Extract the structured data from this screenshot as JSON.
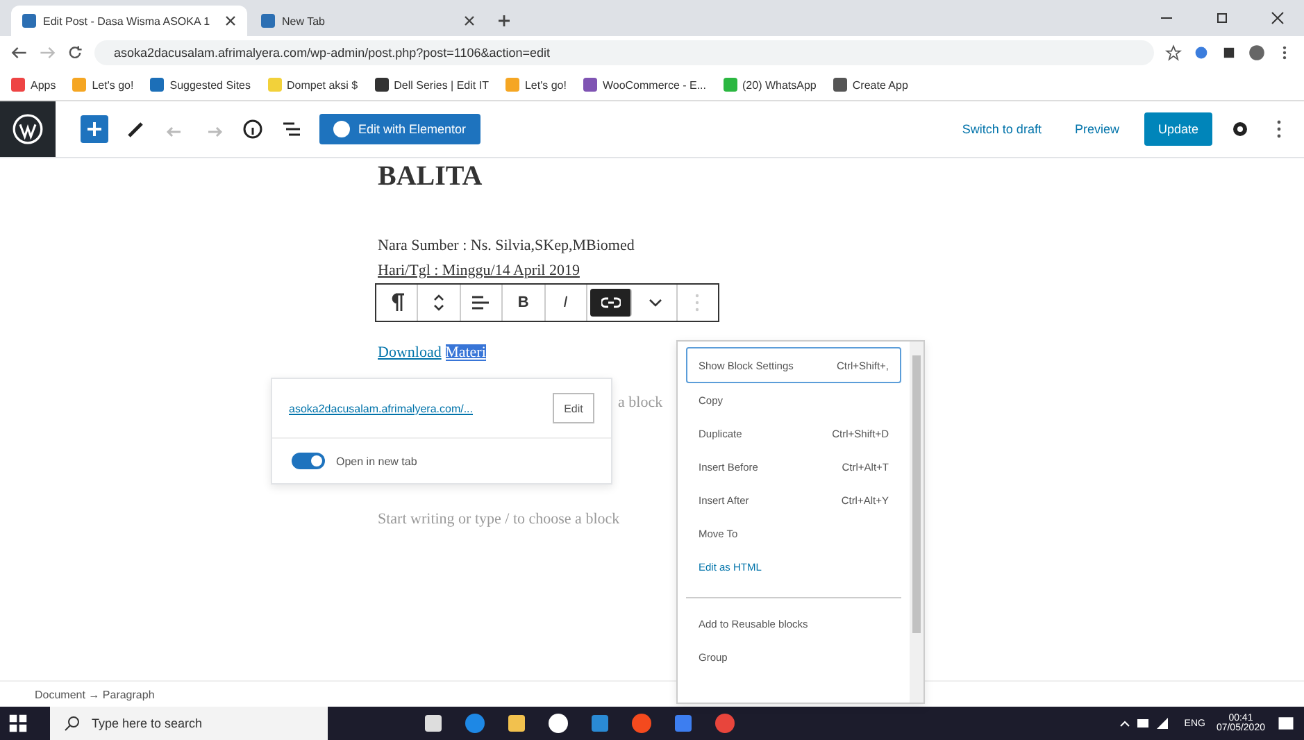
{
  "browser": {
    "tabs": [
      {
        "title": "Edit Post - Dasa Wisma ASOKA 1",
        "selected": true
      },
      {
        "title": "New Tab",
        "selected": false
      }
    ],
    "url": "asoka2dacusalam.afrimalyera.com/wp-admin/post.php?post=1106&action=edit",
    "bookmarks": [
      "Apps",
      "Let's go!",
      "Suggested Sites",
      "Dompet aksi $",
      "Dell Series | Edit IT",
      "Let's go!",
      "WooCommerce - E...",
      "(20) WhatsApp",
      "Create App"
    ]
  },
  "wp_toolbar": {
    "elementor": "Edit with Elementor",
    "switch_draft": "Switch to draft",
    "preview": "Preview",
    "update": "Update"
  },
  "editor": {
    "heading": "BALITA",
    "lines": [
      "Nara Sumber : Ns. Silvia,SKep,MBiomed",
      "Hari/Tgl : Minggu/14 April 2019"
    ],
    "block_toolbar": [
      {
        "kind": "paragraph",
        "selected": false
      },
      {
        "kind": "move",
        "selected": false
      },
      {
        "kind": "align",
        "selected": false
      },
      {
        "kind": "bold",
        "label": "B",
        "selected": false
      },
      {
        "kind": "italic",
        "label": "I",
        "selected": false
      },
      {
        "kind": "link",
        "selected": true
      },
      {
        "kind": "more-formats",
        "selected": false
      },
      {
        "kind": "more",
        "selected": false
      }
    ],
    "link_text": "Download",
    "link_selected": "Materi",
    "behind_text": "a block",
    "placeholder": "Start writing or type / to choose a block"
  },
  "link_popover": {
    "url": "asoka2dacusalam.afrimalyera.com/...",
    "edit": "Edit",
    "toggle": {
      "label": "Open in new tab",
      "on": true
    }
  },
  "context_menu": {
    "groups": [
      [
        {
          "label": "Show Block Settings",
          "shortcut": "Ctrl+Shift+,",
          "selected": true
        },
        {
          "label": "Copy",
          "selected": false
        },
        {
          "label": "Duplicate",
          "shortcut": "Ctrl+Shift+D",
          "selected": false
        },
        {
          "label": "Insert Before",
          "shortcut": "Ctrl+Alt+T",
          "selected": false
        },
        {
          "label": "Insert After",
          "shortcut": "Ctrl+Alt+Y",
          "selected": false
        },
        {
          "label": "Move To",
          "selected": false
        },
        {
          "label": "Edit as HTML",
          "selected": false
        }
      ],
      [
        {
          "label": "Add to Reusable blocks",
          "selected": false
        },
        {
          "label": "Group",
          "selected": false
        }
      ]
    ]
  },
  "status_bar": {
    "breadcrumb": "Document → Paragraph"
  },
  "taskbar": {
    "search": "Type here to search",
    "lang": "ENG",
    "time": "00:41",
    "date": "07/05/2020"
  }
}
